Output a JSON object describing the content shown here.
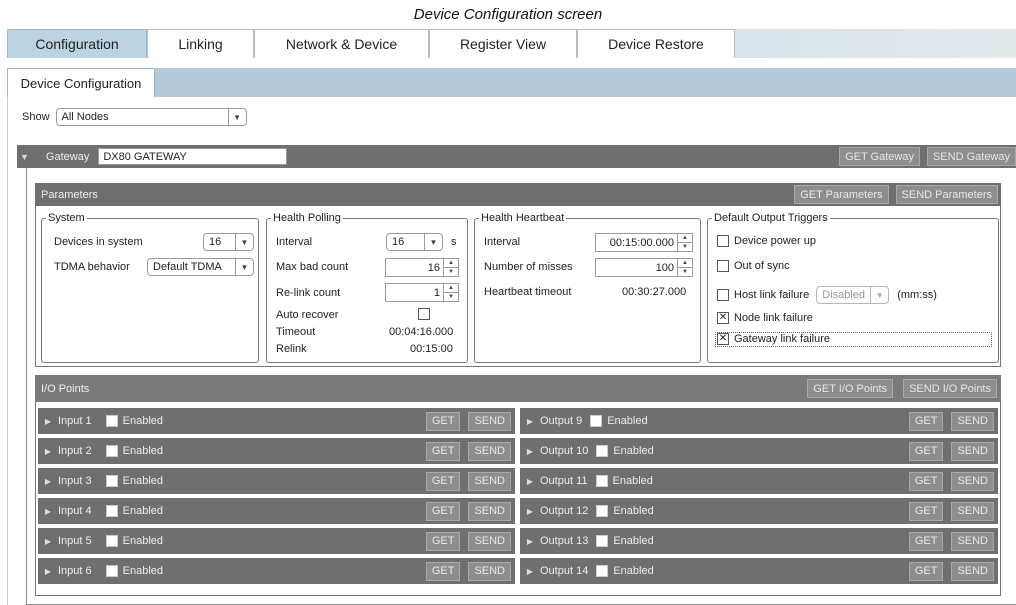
{
  "caption": "Device Configuration screen",
  "tabs": [
    {
      "label": "Configuration",
      "active": true
    },
    {
      "label": "Linking",
      "active": false
    },
    {
      "label": "Network & Device",
      "active": false
    },
    {
      "label": "Register View",
      "active": false
    },
    {
      "label": "Device Restore",
      "active": false
    }
  ],
  "subtab": "Device Configuration",
  "show": {
    "label": "Show",
    "value": "All Nodes"
  },
  "gateway": {
    "label": "Gateway",
    "name": "DX80 GATEWAY",
    "get_button": "GET Gateway",
    "send_button": "SEND Gateway"
  },
  "parameters": {
    "title": "Parameters",
    "get_button": "GET Parameters",
    "send_button": "SEND Parameters",
    "system": {
      "legend": "System",
      "devices_label": "Devices in system",
      "devices_value": "16",
      "tdma_label": "TDMA behavior",
      "tdma_value": "Default TDMA"
    },
    "health_polling": {
      "legend": "Health Polling",
      "interval_label": "Interval",
      "interval_value": "16",
      "interval_unit": "s",
      "max_bad_label": "Max bad count",
      "max_bad_value": "16",
      "relink_count_label": "Re-link count",
      "relink_count_value": "1",
      "auto_recover_label": "Auto recover",
      "auto_recover_checked": false,
      "timeout_label": "Timeout",
      "timeout_value": "00:04:16.000",
      "relink_label": "Relink",
      "relink_value": "00:15:00"
    },
    "health_heartbeat": {
      "legend": "Health Heartbeat",
      "interval_label": "Interval",
      "interval_value": "00:15:00.000",
      "misses_label": "Number of misses",
      "misses_value": "100",
      "timeout_label": "Heartbeat timeout",
      "timeout_value": "00:30:27.000"
    },
    "default_output_triggers": {
      "legend": "Default Output Triggers",
      "device_power_up": "Device power up",
      "out_of_sync": "Out of sync",
      "host_link_failure": "Host link failure",
      "host_link_select": "Disabled",
      "host_link_unit": "(mm:ss)",
      "node_link_failure": "Node link failure",
      "gateway_link_failure": "Gateway link failure"
    }
  },
  "io_points": {
    "title": "I/O Points",
    "get_button": "GET I/O Points",
    "send_button": "SEND I/O Points",
    "enabled_label": "Enabled",
    "get_label": "GET",
    "send_label": "SEND",
    "inputs": [
      "Input 1",
      "Input 2",
      "Input 3",
      "Input 4",
      "Input 5",
      "Input 6"
    ],
    "outputs": [
      "Output 9",
      "Output 10",
      "Output 11",
      "Output 12",
      "Output 13",
      "Output 14"
    ]
  }
}
